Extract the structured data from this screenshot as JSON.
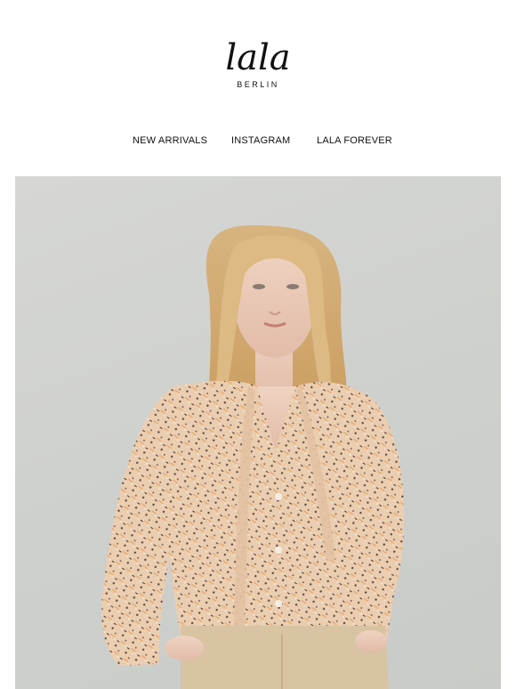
{
  "brand": {
    "logo_script": "lala",
    "logo_sub": "BERLIN"
  },
  "nav": {
    "items": [
      {
        "label": "NEW ARRIVALS"
      },
      {
        "label": "INSTAGRAM"
      },
      {
        "label": "LALA FOREVER"
      }
    ]
  },
  "hero": {
    "icon": "model-photo"
  },
  "colors": {
    "background": "#ffffff",
    "hero_backdrop": "#d2d4d1",
    "text": "#111111",
    "blouse": "#e8cdb2",
    "trousers": "#d8c3a3",
    "hair": "#d9b27a"
  }
}
